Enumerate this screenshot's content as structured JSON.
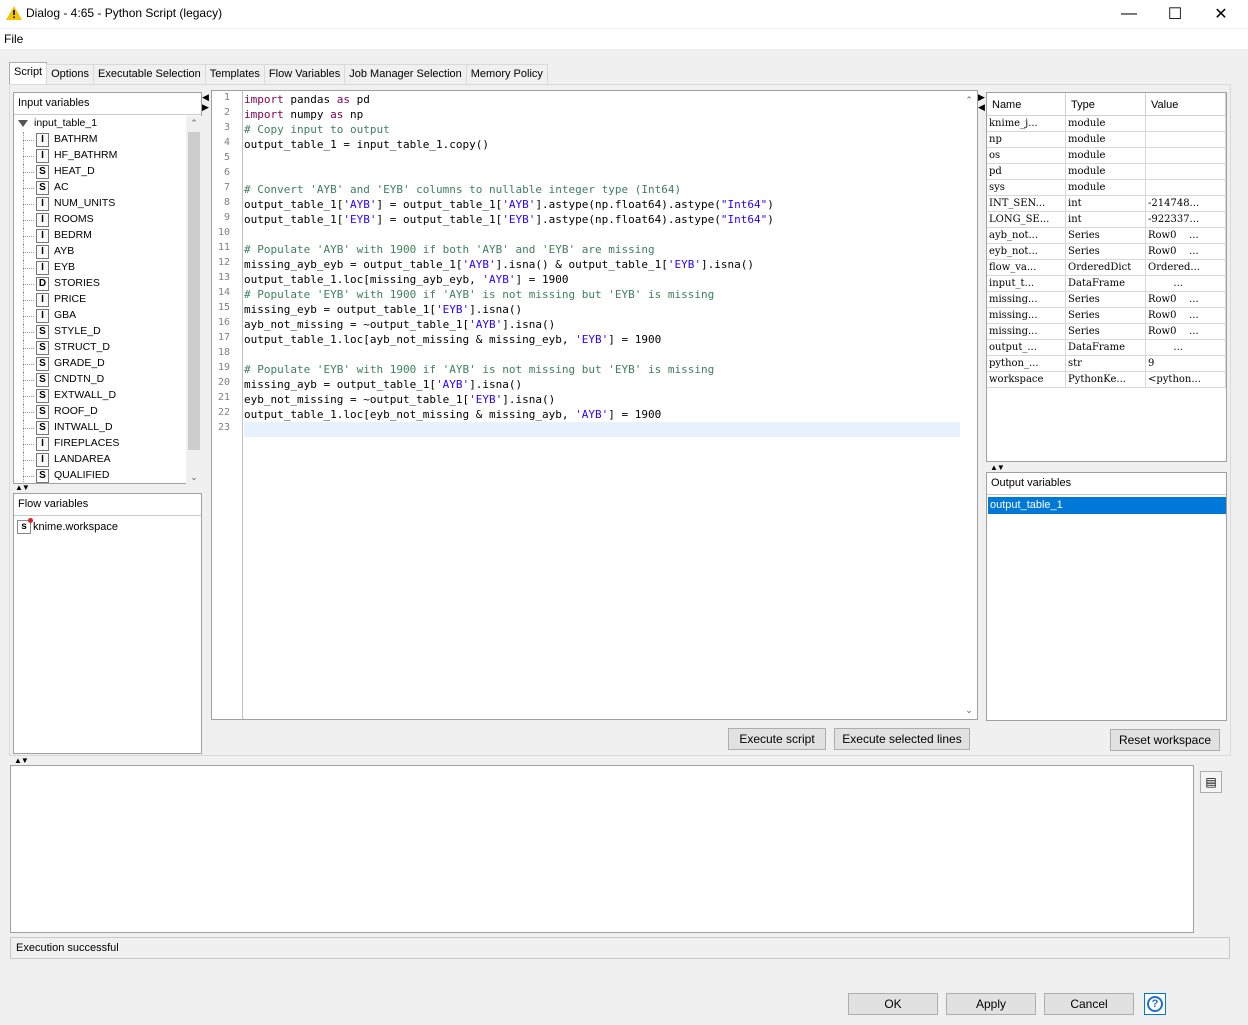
{
  "window": {
    "title": "Dialog - 4:65 - Python Script (legacy)",
    "minimize": "—",
    "maximize": "☐",
    "close": "✕"
  },
  "menu": {
    "file": "File"
  },
  "tabs": [
    "Script",
    "Options",
    "Executable Selection",
    "Templates",
    "Flow Variables",
    "Job Manager Selection",
    "Memory Policy"
  ],
  "input_variables": {
    "header": "Input variables",
    "root": "input_table_1",
    "columns": [
      {
        "type": "I",
        "name": "BATHRM"
      },
      {
        "type": "I",
        "name": "HF_BATHRM"
      },
      {
        "type": "S",
        "name": "HEAT_D"
      },
      {
        "type": "S",
        "name": "AC"
      },
      {
        "type": "I",
        "name": "NUM_UNITS"
      },
      {
        "type": "I",
        "name": "ROOMS"
      },
      {
        "type": "I",
        "name": "BEDRM"
      },
      {
        "type": "I",
        "name": "AYB"
      },
      {
        "type": "I",
        "name": "EYB"
      },
      {
        "type": "D",
        "name": "STORIES"
      },
      {
        "type": "I",
        "name": "PRICE"
      },
      {
        "type": "I",
        "name": "GBA"
      },
      {
        "type": "S",
        "name": "STYLE_D"
      },
      {
        "type": "S",
        "name": "STRUCT_D"
      },
      {
        "type": "S",
        "name": "GRADE_D"
      },
      {
        "type": "S",
        "name": "CNDTN_D"
      },
      {
        "type": "S",
        "name": "EXTWALL_D"
      },
      {
        "type": "S",
        "name": "ROOF_D"
      },
      {
        "type": "S",
        "name": "INTWALL_D"
      },
      {
        "type": "I",
        "name": "FIREPLACES"
      },
      {
        "type": "I",
        "name": "LANDAREA"
      },
      {
        "type": "S",
        "name": "QUALIFIED"
      }
    ]
  },
  "flow_variables": {
    "header": "Flow variables",
    "items": [
      {
        "icon": "s",
        "name": "knime.workspace"
      }
    ]
  },
  "editor": {
    "line_numbers": [
      "1",
      "2",
      "3",
      "4",
      "5",
      "6",
      "7",
      "8",
      "9",
      "10",
      "11",
      "12",
      "13",
      "14",
      "15",
      "16",
      "17",
      "18",
      "19",
      "20",
      "21",
      "22",
      "23"
    ],
    "lines": [
      [
        {
          "t": "import",
          "c": "kw"
        },
        {
          "t": " pandas ",
          "c": ""
        },
        {
          "t": "as",
          "c": "kw"
        },
        {
          "t": " pd",
          "c": ""
        }
      ],
      [
        {
          "t": "import",
          "c": "kw"
        },
        {
          "t": " numpy ",
          "c": ""
        },
        {
          "t": "as",
          "c": "kw"
        },
        {
          "t": " np",
          "c": ""
        }
      ],
      [
        {
          "t": "# Copy input to output",
          "c": "cm"
        }
      ],
      [
        {
          "t": "output_table_1 = input_table_1.copy()",
          "c": ""
        }
      ],
      [],
      [],
      [
        {
          "t": "# Convert 'AYB' and 'EYB' columns to nullable integer type (Int64)",
          "c": "cm"
        }
      ],
      [
        {
          "t": "output_table_1[",
          "c": ""
        },
        {
          "t": "'AYB'",
          "c": "st"
        },
        {
          "t": "] = output_table_1[",
          "c": ""
        },
        {
          "t": "'AYB'",
          "c": "st"
        },
        {
          "t": "].astype(np.float64).astype(",
          "c": ""
        },
        {
          "t": "\"Int64\"",
          "c": "st"
        },
        {
          "t": ")",
          "c": ""
        }
      ],
      [
        {
          "t": "output_table_1[",
          "c": ""
        },
        {
          "t": "'EYB'",
          "c": "st"
        },
        {
          "t": "] = output_table_1[",
          "c": ""
        },
        {
          "t": "'EYB'",
          "c": "st"
        },
        {
          "t": "].astype(np.float64).astype(",
          "c": ""
        },
        {
          "t": "\"Int64\"",
          "c": "st"
        },
        {
          "t": ")",
          "c": ""
        }
      ],
      [],
      [
        {
          "t": "# Populate 'AYB' with 1900 if both 'AYB' and 'EYB' are missing",
          "c": "cm"
        }
      ],
      [
        {
          "t": "missing_ayb_eyb = output_table_1[",
          "c": ""
        },
        {
          "t": "'AYB'",
          "c": "st"
        },
        {
          "t": "].isna() & output_table_1[",
          "c": ""
        },
        {
          "t": "'EYB'",
          "c": "st"
        },
        {
          "t": "].isna()",
          "c": ""
        }
      ],
      [
        {
          "t": "output_table_1.loc[missing_ayb_eyb, ",
          "c": ""
        },
        {
          "t": "'AYB'",
          "c": "st"
        },
        {
          "t": "] = 1900",
          "c": ""
        }
      ],
      [
        {
          "t": "# Populate 'EYB' with 1900 if 'AYB' is not missing but 'EYB' is missing",
          "c": "cm"
        }
      ],
      [
        {
          "t": "missing_eyb = output_table_1[",
          "c": ""
        },
        {
          "t": "'EYB'",
          "c": "st"
        },
        {
          "t": "].isna()",
          "c": ""
        }
      ],
      [
        {
          "t": "ayb_not_missing = ~output_table_1[",
          "c": ""
        },
        {
          "t": "'AYB'",
          "c": "st"
        },
        {
          "t": "].isna()",
          "c": ""
        }
      ],
      [
        {
          "t": "output_table_1.loc[ayb_not_missing & missing_eyb, ",
          "c": ""
        },
        {
          "t": "'EYB'",
          "c": "st"
        },
        {
          "t": "] = 1900",
          "c": ""
        }
      ],
      [],
      [
        {
          "t": "# Populate 'EYB' with 1900 if 'AYB' is not missing but 'EYB' is missing",
          "c": "cm"
        }
      ],
      [
        {
          "t": "missing_ayb = output_table_1[",
          "c": ""
        },
        {
          "t": "'AYB'",
          "c": "st"
        },
        {
          "t": "].isna()",
          "c": ""
        }
      ],
      [
        {
          "t": "eyb_not_missing = ~output_table_1[",
          "c": ""
        },
        {
          "t": "'EYB'",
          "c": "st"
        },
        {
          "t": "].isna()",
          "c": ""
        }
      ],
      [
        {
          "t": "output_table_1.loc[eyb_not_missing & missing_ayb, ",
          "c": ""
        },
        {
          "t": "'AYB'",
          "c": "st"
        },
        {
          "t": "] = 1900",
          "c": ""
        }
      ],
      []
    ],
    "execute_script": "Execute script",
    "execute_selected": "Execute selected lines"
  },
  "workspace": {
    "headers": [
      "Name",
      "Type",
      "Value"
    ],
    "rows": [
      [
        "knime_j...",
        "module",
        ""
      ],
      [
        "np",
        "module",
        ""
      ],
      [
        "os",
        "module",
        ""
      ],
      [
        "pd",
        "module",
        ""
      ],
      [
        "sys",
        "module",
        ""
      ],
      [
        "INT_SEN...",
        "int",
        "-214748..."
      ],
      [
        "LONG_SE...",
        "int",
        "-922337..."
      ],
      [
        "ayb_not...",
        "Series",
        "Row0    ..."
      ],
      [
        "eyb_not...",
        "Series",
        "Row0    ..."
      ],
      [
        "flow_va...",
        "OrderedDict",
        "Ordered..."
      ],
      [
        "input_t...",
        "DataFrame",
        "        ..."
      ],
      [
        "missing...",
        "Series",
        "Row0    ..."
      ],
      [
        "missing...",
        "Series",
        "Row0    ..."
      ],
      [
        "missing...",
        "Series",
        "Row0    ..."
      ],
      [
        "output_...",
        "DataFrame",
        "        ..."
      ],
      [
        "python_...",
        "str",
        "9"
      ],
      [
        "workspace",
        "PythonKe...",
        "<python..."
      ]
    ],
    "reset": "Reset workspace"
  },
  "output_variables": {
    "header": "Output variables",
    "items": [
      "output_table_1"
    ]
  },
  "status": "Execution successful",
  "footer": {
    "ok": "OK",
    "apply": "Apply",
    "cancel": "Cancel",
    "help": "?"
  },
  "colors": {
    "selection": "#0078d7",
    "keyword": "#7f0055",
    "comment": "#3f7f5f",
    "string": "#2a00ff"
  }
}
